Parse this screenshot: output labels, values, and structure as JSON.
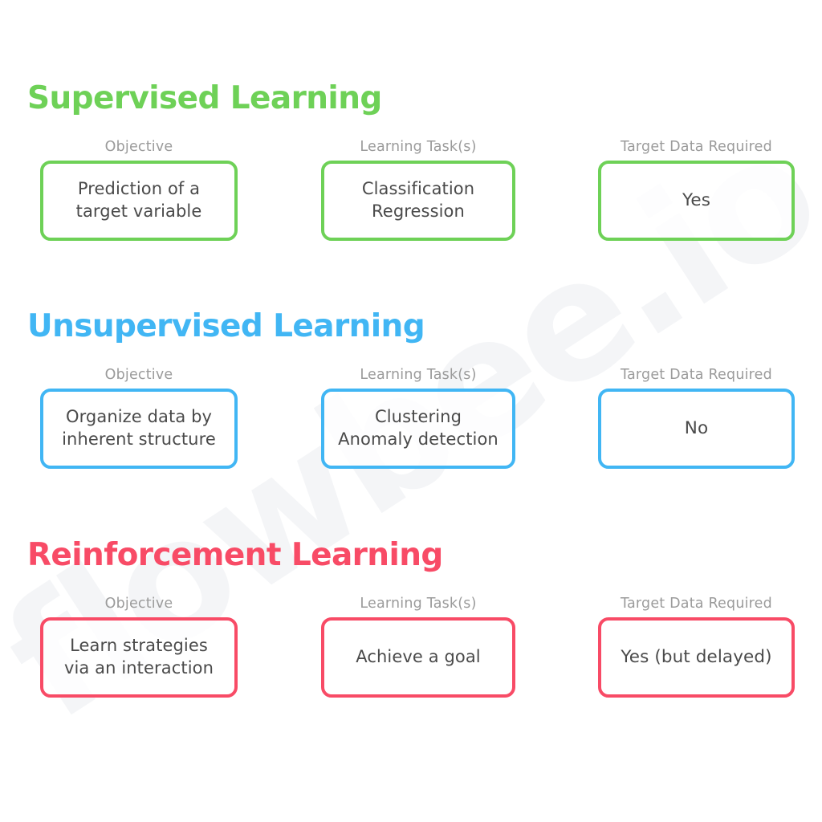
{
  "watermark": {
    "text": "flowbee.io"
  },
  "colors": {
    "supervised": "#6ed157",
    "unsupervised": "#41b6f4",
    "reinforcement": "#f84b66",
    "label_gray": "#9b9b9b",
    "body_text": "#4a4a4a",
    "background": "#ffffff"
  },
  "column_labels": {
    "objective": "Objective",
    "learning_tasks": "Learning Task(s)",
    "target_data": "Target Data Required"
  },
  "sections": [
    {
      "id": "supervised",
      "heading": "Supervised Learning",
      "color": "#6ed157",
      "cards": [
        {
          "label": "Objective",
          "text": "Prediction of a\ntarget variable"
        },
        {
          "label": "Learning Task(s)",
          "text": "Classification\nRegression"
        },
        {
          "label": "Target Data Required",
          "text": "Yes"
        }
      ]
    },
    {
      "id": "unsupervised",
      "heading": "Unsupervised Learning",
      "color": "#41b6f4",
      "cards": [
        {
          "label": "Objective",
          "text": "Organize data by\ninherent structure"
        },
        {
          "label": "Learning Task(s)",
          "text": "Clustering\nAnomaly detection"
        },
        {
          "label": "Target Data Required",
          "text": "No"
        }
      ]
    },
    {
      "id": "reinforcement",
      "heading": "Reinforcement Learning",
      "color": "#f84b66",
      "cards": [
        {
          "label": "Objective",
          "text": "Learn strategies\nvia an interaction"
        },
        {
          "label": "Learning Task(s)",
          "text": "Achieve a goal"
        },
        {
          "label": "Target Data Required",
          "text": "Yes (but delayed)"
        }
      ]
    }
  ]
}
